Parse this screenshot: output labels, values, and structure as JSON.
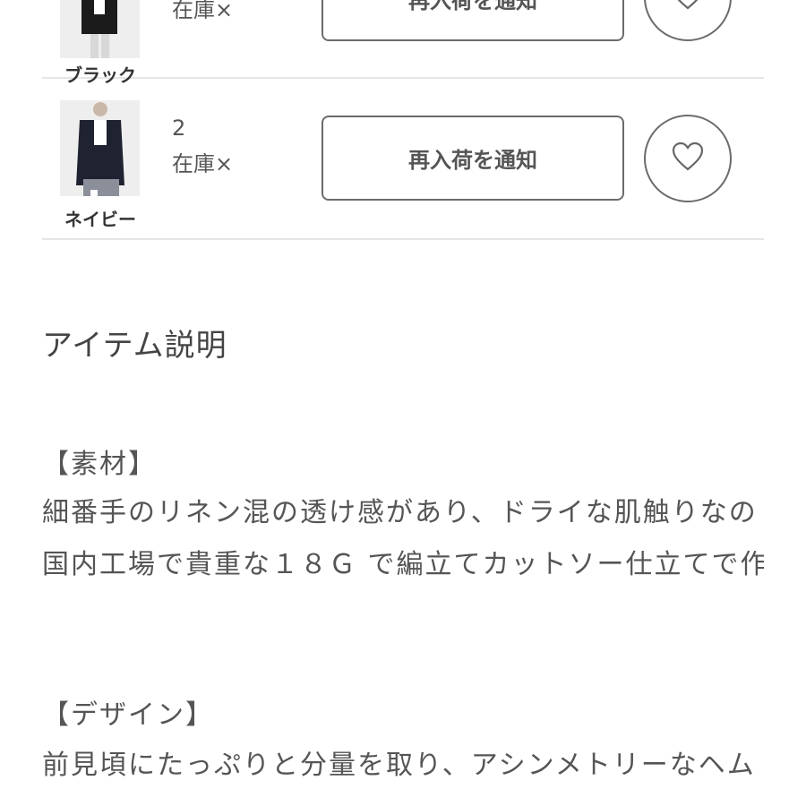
{
  "variants": [
    {
      "color_label": "ブラック",
      "size": "",
      "stock": "在庫×",
      "notify_label": "再入荷を通知",
      "icon": "heart-icon"
    },
    {
      "color_label": "ネイビー",
      "size": "2",
      "stock": "在庫×",
      "notify_label": "再入荷を通知",
      "icon": "heart-icon"
    }
  ],
  "description": {
    "heading": "アイテム説明",
    "material_heading": "【素材】",
    "material_line1": "細番手のリネン混の透け感があり、ドライな肌触りなの",
    "material_line2": "国内工場で貴重な１８Ｇ で編立てカットソー仕立てで作",
    "design_heading": "【デザイン】",
    "design_line1": "前見頃にたっぷりと分量を取り、アシンメトリーなヘム"
  },
  "colors": {
    "border": "#6b6b6b",
    "divider": "#e6e6e6",
    "text": "#555555"
  }
}
